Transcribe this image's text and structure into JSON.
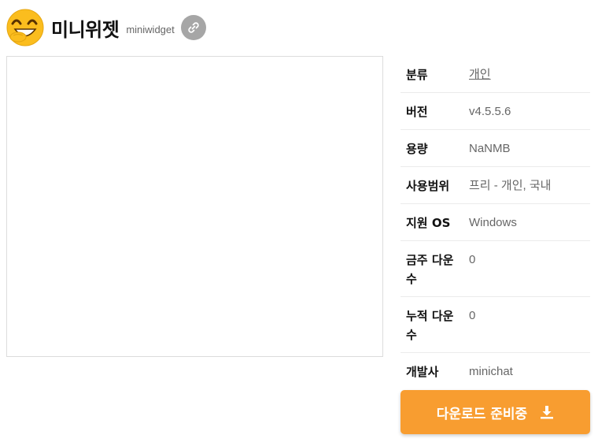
{
  "header": {
    "title": "미니위젯",
    "app_id": "miniwidget"
  },
  "info": [
    {
      "label": "분류",
      "value": "개인",
      "link": true
    },
    {
      "label": "버전",
      "value": "v4.5.5.6"
    },
    {
      "label": "용량",
      "value": "NaNMB"
    },
    {
      "label": "사용범위",
      "value": "프리 - 개인, 국내"
    },
    {
      "label": "지원 OS",
      "value": "Windows"
    },
    {
      "label": "금주 다운수",
      "value": "0"
    },
    {
      "label": "누적 다운수",
      "value": "0"
    },
    {
      "label": "개발사",
      "value": "minichat"
    }
  ],
  "download": {
    "label": "다운로드 준비중"
  },
  "colors": {
    "accent": "#f89d30",
    "link_button": "#a6a6a6"
  },
  "icons": [
    "emoji-logo-icon",
    "link-icon",
    "download-icon"
  ]
}
